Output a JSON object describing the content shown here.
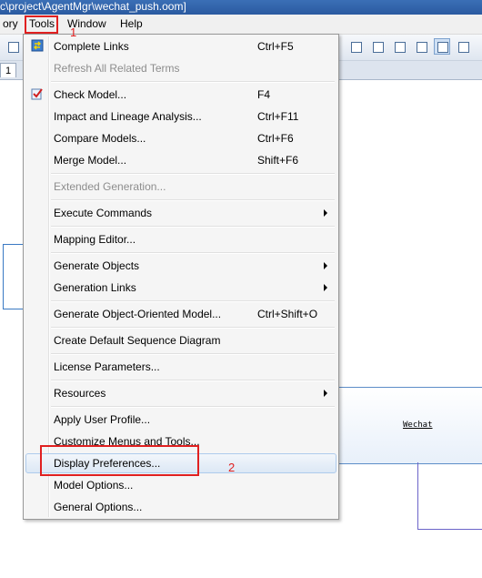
{
  "window": {
    "title": "c\\project\\AgentMgr\\wechat_push.oom]"
  },
  "menubar": {
    "items": [
      "ory",
      "Tools",
      "Window",
      "Help"
    ]
  },
  "tabs": {
    "first": "1"
  },
  "canvas": {
    "label": "Wechat"
  },
  "annotations": {
    "step1": "1",
    "step2": "2"
  },
  "menu": {
    "items": [
      {
        "label": "Complete Links",
        "shortcut": "Ctrl+F5",
        "icon": "complete-links-icon",
        "enabled": true
      },
      {
        "label": "Refresh All Related Terms",
        "shortcut": "",
        "enabled": false
      },
      {
        "label": "Check Model...",
        "shortcut": "F4",
        "icon": "check-model-icon",
        "enabled": true
      },
      {
        "label": "Impact and Lineage Analysis...",
        "shortcut": "Ctrl+F11",
        "enabled": true
      },
      {
        "label": "Compare Models...",
        "shortcut": "Ctrl+F6",
        "enabled": true
      },
      {
        "label": "Merge Model...",
        "shortcut": "Shift+F6",
        "enabled": true
      },
      {
        "label": "Extended Generation...",
        "shortcut": "",
        "enabled": false
      },
      {
        "label": "Execute Commands",
        "shortcut": "",
        "submenu": true,
        "enabled": true
      },
      {
        "label": "Mapping Editor...",
        "shortcut": "",
        "enabled": true
      },
      {
        "label": "Generate Objects",
        "shortcut": "",
        "submenu": true,
        "enabled": true
      },
      {
        "label": "Generation Links",
        "shortcut": "",
        "submenu": true,
        "enabled": true
      },
      {
        "label": "Generate Object-Oriented Model...",
        "shortcut": "Ctrl+Shift+O",
        "enabled": true
      },
      {
        "label": "Create Default Sequence Diagram",
        "shortcut": "",
        "enabled": true
      },
      {
        "label": "License Parameters...",
        "shortcut": "",
        "enabled": true
      },
      {
        "label": "Resources",
        "shortcut": "",
        "submenu": true,
        "enabled": true
      },
      {
        "label": "Apply User Profile...",
        "shortcut": "",
        "enabled": true
      },
      {
        "label": "Customize Menus and Tools...",
        "shortcut": "",
        "enabled": true
      },
      {
        "label": "Display Preferences...",
        "shortcut": "",
        "enabled": true,
        "highlighted": true
      },
      {
        "label": "Model Options...",
        "shortcut": "",
        "enabled": true
      },
      {
        "label": "General Options...",
        "shortcut": "",
        "enabled": true
      }
    ]
  },
  "colors": {
    "highlight_border": "#aecbec",
    "annotation_red": "#e02020",
    "title_bar": "#2a5aa0"
  }
}
